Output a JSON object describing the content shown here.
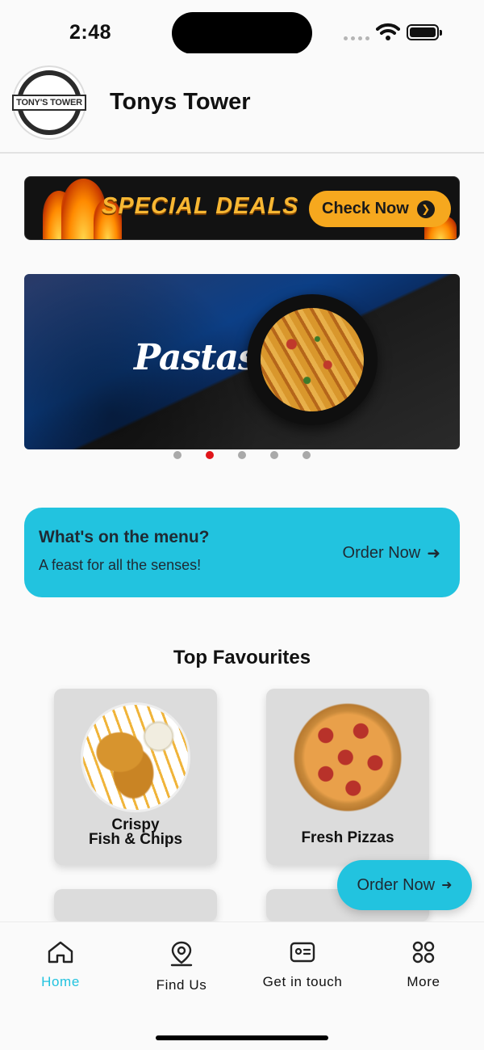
{
  "status_bar": {
    "time": "2:48"
  },
  "header": {
    "title": "Tonys Tower",
    "logo_text": "TONY'S TOWER"
  },
  "deals_banner": {
    "text": "SPECIAL DEALS",
    "button_label": "Check Now"
  },
  "carousel": {
    "slide_label": "Pastas",
    "slide_count": 5,
    "active_index": 1
  },
  "menu_card": {
    "title": "What's on the menu?",
    "subtitle": "A feast for all the senses!",
    "action_label": "Order Now"
  },
  "favourites": {
    "title": "Top Favourites",
    "items": [
      {
        "label_line1": "Crispy",
        "label_line2": "Fish & Chips",
        "icon": "fish-and-chips-image"
      },
      {
        "label": "Fresh Pizzas",
        "icon": "pizza-image"
      }
    ]
  },
  "fab": {
    "label": "Order Now"
  },
  "bottom_nav": {
    "items": [
      {
        "label": "Home",
        "icon": "home-icon",
        "active": true
      },
      {
        "label": "Find Us",
        "icon": "location-pin-icon",
        "active": false
      },
      {
        "label": "Get in touch",
        "icon": "contact-card-icon",
        "active": false
      },
      {
        "label": "More",
        "icon": "grid-icon",
        "active": false
      }
    ]
  },
  "colors": {
    "accent": "#22c3df",
    "active_dot": "#e0151a",
    "deals_button": "#f6a81e"
  }
}
